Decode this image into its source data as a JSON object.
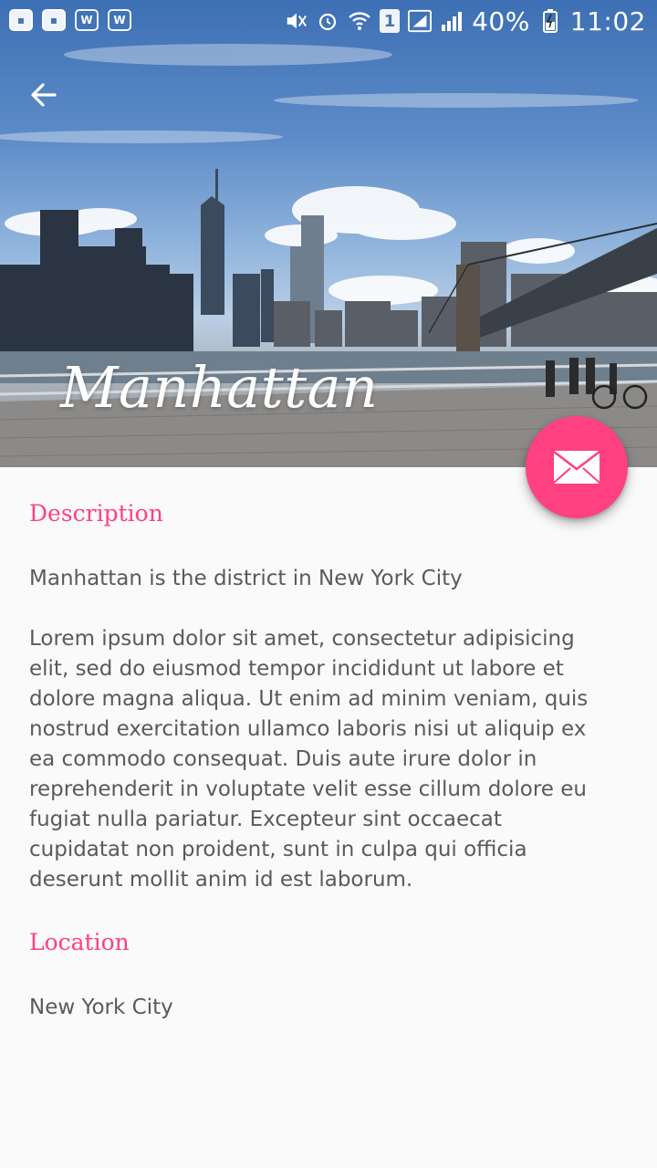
{
  "status_bar": {
    "battery": "40%",
    "time": "11:02",
    "sim_number": "1",
    "left_icons": [
      "bbm-icon",
      "bbm-icon",
      "w-app-icon",
      "w-app-icon"
    ],
    "right_icons": [
      "mute-icon",
      "alarm-icon",
      "wifi-icon",
      "sim-icon",
      "signal-icon",
      "signal-icon",
      "battery-charging-icon"
    ]
  },
  "header": {
    "title": "Manhattan",
    "back_icon": "arrow-back-icon"
  },
  "fab": {
    "icon": "mail-icon",
    "color": "#ff4081"
  },
  "sections": {
    "description_title": "Description",
    "description_summary": "Manhattan is the district in New York City",
    "description_body": "Lorem ipsum dolor sit amet, consectetur adipisicing elit, sed do eiusmod tempor incididunt ut labore et dolore magna aliqua. Ut enim ad minim veniam, quis nostrud exercitation ullamco laboris nisi ut aliquip ex ea commodo consequat. Duis aute irure dolor in reprehenderit in voluptate velit esse cillum dolore eu fugiat nulla pariatur. Excepteur sint occaecat cupidatat non proident, sunt in culpa qui officia deserunt mollit anim id est laborum.",
    "location_title": "Location",
    "location_value": "New York City"
  },
  "colors": {
    "accent": "#ff4081",
    "body_text": "#5a5a5a",
    "background": "#fafafa"
  }
}
